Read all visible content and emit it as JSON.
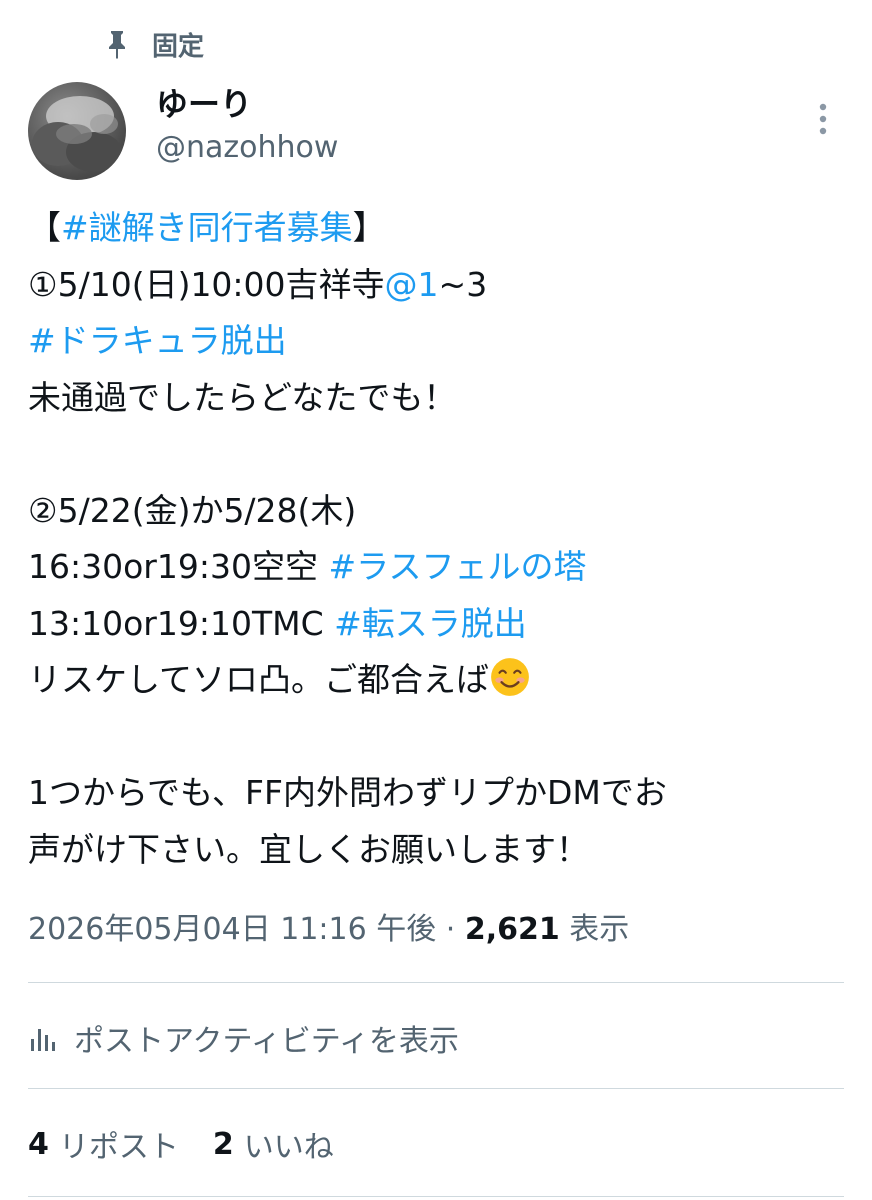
{
  "pinned_label": "固定",
  "author": {
    "display_name": "ゆーり",
    "handle": "@nazohhow"
  },
  "tweet": {
    "lines": [
      [
        {
          "t": "【",
          "link": false
        },
        {
          "t": "#謎解き同行者募集",
          "link": true
        },
        {
          "t": "】",
          "link": false
        }
      ],
      [
        {
          "t": "①5/10(日)10:00吉祥寺",
          "link": false
        },
        {
          "t": "@1",
          "link": true
        },
        {
          "t": "~3",
          "link": false
        }
      ],
      [
        {
          "t": "#ドラキュラ脱出",
          "link": true
        }
      ],
      [
        {
          "t": "未通過でしたらどなたでも！",
          "link": false
        }
      ],
      [],
      [
        {
          "t": "②5/22(金)か5/28(木)",
          "link": false
        }
      ],
      [
        {
          "t": "16:30or19:30空空 ",
          "link": false
        },
        {
          "t": "#ラスフェルの塔",
          "link": true
        }
      ],
      [
        {
          "t": "13:10or19:10TMC ",
          "link": false
        },
        {
          "t": "#転スラ脱出",
          "link": true
        }
      ],
      [
        {
          "t": "リスケしてソロ凸。ご都合えば",
          "link": false
        },
        {
          "emoji": "smiling-face-emoji"
        }
      ],
      [],
      [
        {
          "t": "1つからでも、FF内外問わずリプかDMでお",
          "link": false
        }
      ],
      [
        {
          "t": "声がけ下さい。宜しくお願いします！",
          "link": false
        }
      ]
    ]
  },
  "meta": {
    "timestamp": "2026年05月04日 11:16 午後",
    "separator": " · ",
    "views_count": "2,621",
    "views_label": "表示"
  },
  "activity_label": "ポストアクティビティを表示",
  "stats": {
    "reposts_count": "4",
    "reposts_label": "リポスト",
    "likes_count": "2",
    "likes_label": "いいね"
  },
  "colors": {
    "link": "#1d9bf0",
    "secondary_text": "#536471",
    "primary_text": "#0f1419",
    "divider": "#cfd9de"
  },
  "icons": [
    "pin-icon",
    "more-vertical-icon",
    "analytics-icon",
    "smiling-face-emoji"
  ]
}
